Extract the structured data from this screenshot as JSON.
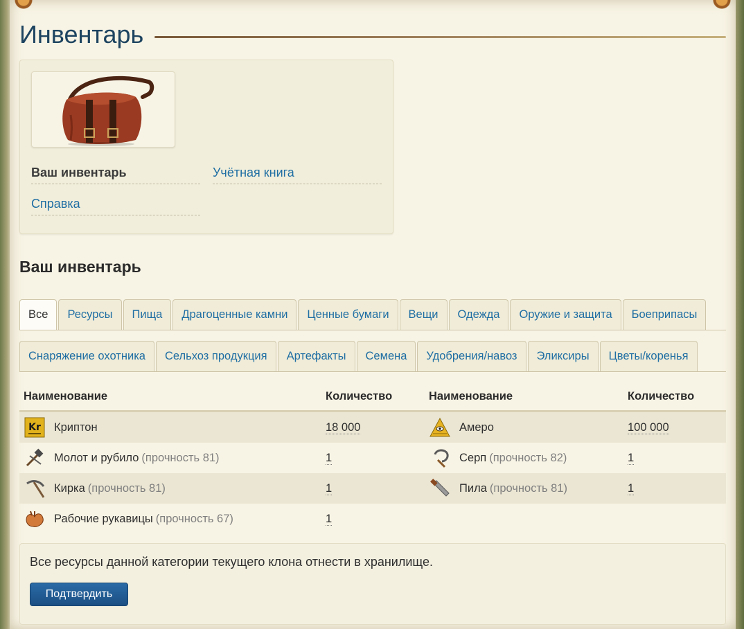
{
  "page": {
    "title": "Инвентарь"
  },
  "menu": {
    "items": [
      {
        "label": "Ваш инвентарь"
      },
      {
        "label": "Учётная книга"
      },
      {
        "label": "Справка"
      }
    ]
  },
  "section": {
    "title": "Ваш инвентарь"
  },
  "tabs": {
    "row1": [
      "Все",
      "Ресурсы",
      "Пища",
      "Драгоценные камни",
      "Ценные бумаги",
      "Вещи",
      "Одежда",
      "Оружие и защита",
      "Боеприпасы"
    ],
    "row2": [
      "Снаряжение охотника",
      "Сельхоз продукция",
      "Артефакты",
      "Семена",
      "Удобрения/навоз",
      "Эликсиры",
      "Цветы/коренья"
    ],
    "active": "Все"
  },
  "table": {
    "headers": {
      "name": "Наименование",
      "qty": "Количество"
    },
    "rows": [
      {
        "left": {
          "icon": "krypton-icon",
          "name": "Криптон",
          "durability": "",
          "qty": "18 000"
        },
        "right": {
          "icon": "amero-icon",
          "name": "Амеро",
          "durability": "",
          "qty": "100 000"
        }
      },
      {
        "left": {
          "icon": "hammer-chisel-icon",
          "name": "Молот и рубило",
          "durability": "(прочность 81)",
          "qty": "1"
        },
        "right": {
          "icon": "sickle-icon",
          "name": "Серп",
          "durability": "(прочность 82)",
          "qty": "1"
        }
      },
      {
        "left": {
          "icon": "pickaxe-icon",
          "name": "Кирка",
          "durability": "(прочность 81)",
          "qty": "1"
        },
        "right": {
          "icon": "saw-icon",
          "name": "Пила",
          "durability": "(прочность 81)",
          "qty": "1"
        }
      },
      {
        "left": {
          "icon": "gloves-icon",
          "name": "Рабочие рукавицы",
          "durability": "(прочность 67)",
          "qty": "1"
        },
        "right": null
      }
    ]
  },
  "footer": {
    "text": "Все ресурсы данной категории текущего клона отнести в хранилище.",
    "button": "Подтвердить"
  },
  "colors": {
    "link": "#1f6ea3",
    "title": "#1d4460",
    "button": "#1b4f83",
    "paper": "#f8f4e5"
  }
}
